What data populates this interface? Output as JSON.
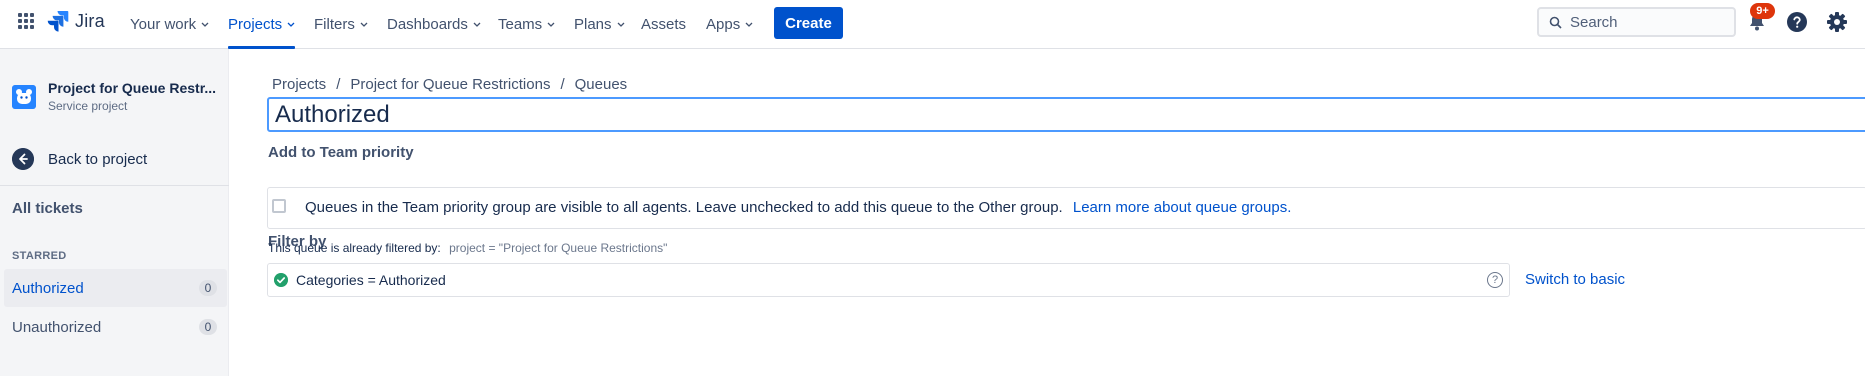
{
  "topnav": {
    "brand": "Jira",
    "items": [
      {
        "label": "Your work",
        "dropdown": true
      },
      {
        "label": "Projects",
        "dropdown": true,
        "active": true
      },
      {
        "label": "Filters",
        "dropdown": true
      },
      {
        "label": "Dashboards",
        "dropdown": true
      },
      {
        "label": "Teams",
        "dropdown": true
      },
      {
        "label": "Plans",
        "dropdown": true
      },
      {
        "label": "Assets",
        "dropdown": false
      },
      {
        "label": "Apps",
        "dropdown": true
      }
    ],
    "create_label": "Create",
    "search_placeholder": "Search",
    "notification_badge": "9+",
    "accent": "#0052cc"
  },
  "sidebar": {
    "project_name": "Project for Queue Restr...",
    "project_type": "Service project",
    "back_label": "Back to project",
    "all_tickets": "All tickets",
    "starred_heading": "STARRED",
    "queues": [
      {
        "label": "Authorized",
        "count": "0",
        "selected": true
      },
      {
        "label": "Unauthorized",
        "count": "0",
        "selected": false
      }
    ]
  },
  "main": {
    "breadcrumbs": [
      "Projects",
      "Project for Queue Restrictions",
      "Queues"
    ],
    "queue_name": "Authorized",
    "team_priority": {
      "heading": "Add to Team priority",
      "text": "Queues in the Team priority group are visible to all agents. Leave unchecked to add this queue to the Other group.",
      "link": "Learn more about queue groups.",
      "checked": false
    },
    "filter": {
      "heading": "Filter by",
      "note": "This queue is already filtered by:",
      "existing_query": "project = \"Project for Queue Restrictions\"",
      "jql": "Categories = Authorized",
      "help": "?",
      "switch_label": "Switch to basic"
    }
  }
}
